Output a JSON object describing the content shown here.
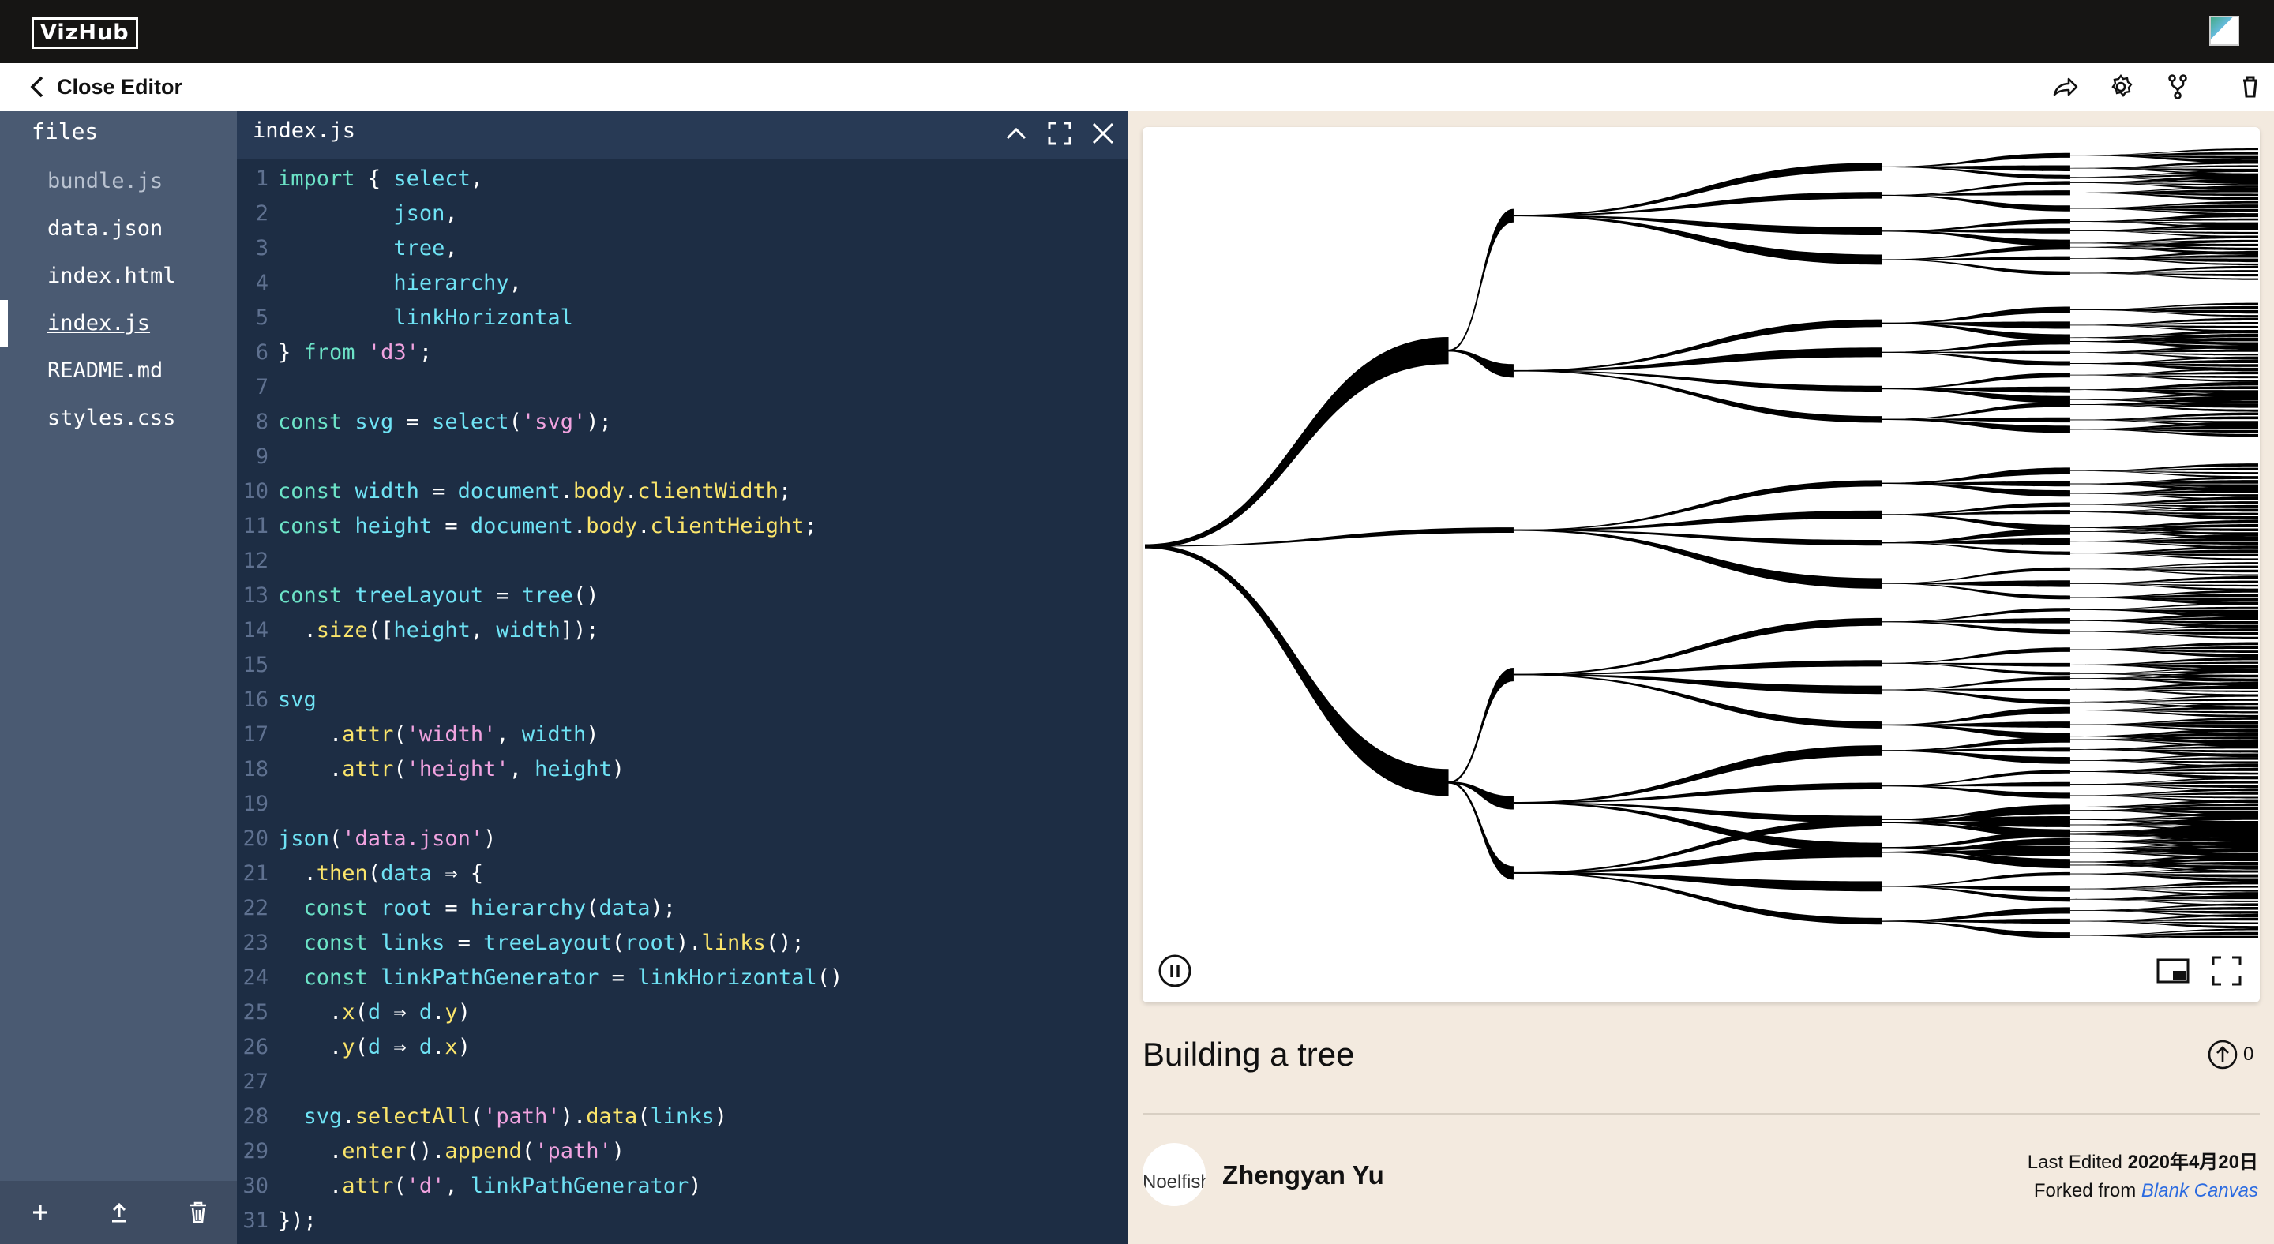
{
  "topbar": {
    "logo": "VizHub",
    "avatar_icon": "user-avatar-icon"
  },
  "subbar": {
    "close_label": "Close Editor",
    "icons": [
      "share-icon",
      "gear-icon",
      "fork-icon",
      "trash-icon"
    ]
  },
  "sidebar": {
    "header": "files",
    "files": [
      "bundle.js",
      "data.json",
      "index.html",
      "index.js",
      "README.md",
      "styles.css"
    ],
    "active": "index.js",
    "bottom_icons": [
      "add-icon",
      "upload-icon",
      "trash-icon"
    ]
  },
  "editor": {
    "filename": "index.js",
    "icons": [
      "chevron-up-icon",
      "fullscreen-icon",
      "close-icon"
    ],
    "lines": [
      "import { select,",
      "         json,",
      "         tree,",
      "         hierarchy,",
      "         linkHorizontal",
      "} from 'd3';",
      "",
      "const svg = select('svg');",
      "",
      "const width = document.body.clientWidth;",
      "const height = document.body.clientHeight;",
      "",
      "const treeLayout = tree()",
      "  .size([height, width]);",
      "",
      "svg",
      "    .attr('width', width)",
      "    .attr('height', height)",
      "",
      "json('data.json')",
      "  .then(data ⇒ {",
      "  const root = hierarchy(data);",
      "  const links = treeLayout(root).links();",
      "  const linkPathGenerator = linkHorizontal()",
      "    .x(d ⇒ d.y)",
      "    .y(d ⇒ d.x)",
      "",
      "  svg.selectAll('path').data(links)",
      "    .enter().append('path')",
      "    .attr('d', linkPathGenerator)",
      "});"
    ]
  },
  "preview": {
    "controls": [
      "pause-icon",
      "picture-in-picture-icon",
      "fullscreen-icon"
    ],
    "title": "Building a tree",
    "upvotes": "0",
    "author_avatar_alt": "Noelfisho",
    "author": "Zhengyan Yu",
    "last_edited_label": "Last Edited",
    "last_edited_date": "2020年4月20日",
    "forked_from_label": "Forked from",
    "forked_from_link": "Blank Canvas"
  }
}
